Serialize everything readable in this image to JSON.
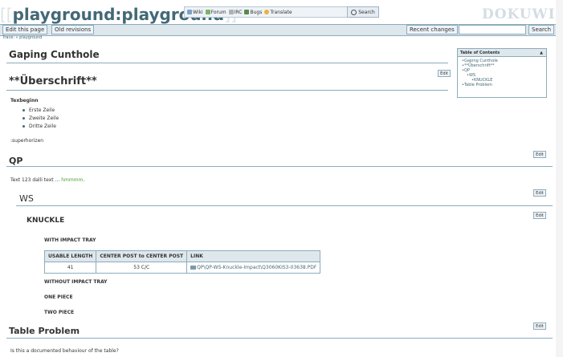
{
  "header": {
    "title": "playground:playground",
    "toolbar": [
      "Wiki",
      "Forum",
      "IRC",
      "Bugs",
      "Translate"
    ],
    "search_button": "Search",
    "logo_text": "DOKUWIKI"
  },
  "actions": {
    "edit_label": "Edit this page",
    "old_label": "Old revisions",
    "recent_label": "Recent changes",
    "search_label": "Search"
  },
  "trace": "Trace: » playground",
  "content": {
    "h_gaping": "Gaping Cunthole",
    "h_ueber": "**Überschrift**",
    "edit": "Edit",
    "texbeginn": "Texbeginn",
    "list": [
      "Erste Zeile",
      "Zweite Zeile",
      "Dritte Zeile"
    ],
    "superhorizen": ":superhorizen",
    "h_qp": "QP",
    "qp_text": "Text 123 dalli text ...",
    "qp_link": "hmmmm",
    "h_ws": "WS",
    "h_knuckle": "KNUCKLE",
    "with_tray": "WITH IMPACT TRAY",
    "table": {
      "headers": [
        "USABLE LENGTH",
        "CENTER POST to CENTER POST",
        "LINK"
      ],
      "row": [
        "41",
        "53 C/C",
        "QP\\QP-WS-Knuckle-Impact\\Q3060KIS3-03638.PDF"
      ]
    },
    "without_tray": "WITHOUT IMPACT TRAY",
    "one_piece": "ONE PIECE",
    "two_piece": "TWO PIECE",
    "h_table": "Table Problem",
    "table_q": "Is this a documented behaviour of the table?"
  },
  "toc": {
    "title": "Table of Contents",
    "items": [
      "Gaping Cunthole",
      "**Überschrift**",
      "QP",
      "WS",
      "KNUCKLE",
      "Table Problem"
    ]
  },
  "colors": {
    "accent": "#436976",
    "bar": "#dee7ec",
    "border": "#8cacbb",
    "link_green": "#4a9c3a"
  }
}
